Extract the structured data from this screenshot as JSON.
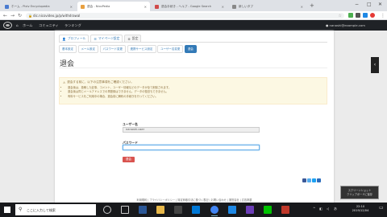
{
  "browser": {
    "tabs": [
      {
        "label": "ホーム - Pixiv Encyclopedia",
        "active": false,
        "favicon_color": "#4a7bd0"
      },
      {
        "label": "退会 - NicoPedia",
        "active": true,
        "favicon_color": "#e8a040"
      },
      {
        "label": "退会手続き - ヘルプ - Google Search",
        "active": false,
        "favicon_color": "#d04a4a"
      },
      {
        "label": "新しいタブ",
        "active": false,
        "favicon_color": "#888888"
      }
    ],
    "new_tab": "+",
    "url": "dic.nicovideo.jp/p/withdrawal",
    "window_controls": {
      "minimize": "−",
      "maximize": "□",
      "close": "✕"
    }
  },
  "site": {
    "nav": [
      "ホーム",
      "コミュニティ",
      "ランキング"
    ],
    "user": "nanashi@example.com"
  },
  "account_tabs": [
    {
      "label": "プロフィール",
      "icon": "user-icon",
      "active": false
    },
    {
      "label": "マイページ設定",
      "icon": "settings-icon",
      "active": false
    },
    {
      "label": "設定",
      "icon": "gear-icon",
      "active": true
    }
  ],
  "sub_tabs": [
    {
      "label": "基本設定",
      "active": false
    },
    {
      "label": "メール設定",
      "active": false
    },
    {
      "label": "パスワード変更",
      "active": false
    },
    {
      "label": "連携サービス設定",
      "active": false
    },
    {
      "label": "ユーザー名変更",
      "active": false
    },
    {
      "label": "退会",
      "active": true
    }
  ],
  "page_title": "退会",
  "warning": {
    "heading": "退会する前に、以下の注意事項をご確認ください。",
    "items": [
      "退会後は、投稿した記事、コメント、ユーザー情報などのデータが全て削除されます。",
      "退会後は同じメールアドレスでの再登録はできません。データの復旧もできません。",
      "有料サービスをご利用中の場合、退会前に解約の手続きを行ってください。"
    ]
  },
  "form": {
    "user_label": "ユーザー名",
    "user_value": "nanashi.user",
    "password_label": "パスワード",
    "password_value": "",
    "submit_label": "退会"
  },
  "footer": "利用規約 | プライバシーポリシー | 特定商取引法に基づく表記 | お問い合わせ | 運営会社 | 広告掲載",
  "notification": [
    "スクリーンショット",
    "クリップボードに保存"
  ],
  "taskbar": {
    "search_placeholder": "ここに入力して検索",
    "tray_lang": "あ",
    "time": "22:10",
    "date": "2019/12/04"
  },
  "colors": {
    "accent": "#337ab7",
    "danger": "#d9534f",
    "warning_bg": "#fcf8e3",
    "warning_text": "#8a6d3b",
    "header_bg": "#1f2226"
  }
}
